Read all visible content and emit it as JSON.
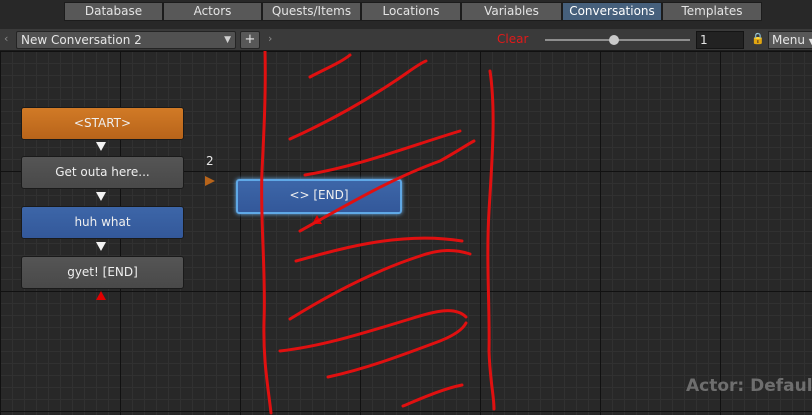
{
  "tabs": [
    {
      "label": "Database",
      "active": false
    },
    {
      "label": "Actors",
      "active": false
    },
    {
      "label": "Quests/Items",
      "active": false
    },
    {
      "label": "Locations",
      "active": false
    },
    {
      "label": "Variables",
      "active": false
    },
    {
      "label": "Conversations",
      "active": true
    },
    {
      "label": "Templates",
      "active": false
    }
  ],
  "toolbar": {
    "conversation": "New Conversation 2",
    "add_label": "+",
    "clear_label": "Clear",
    "zoom_value": "1",
    "menu_label": "Menu"
  },
  "nodes": {
    "start": "<START>",
    "n1": "Get outa here...",
    "n2": "huh what",
    "n3": "gyet! [END]",
    "selected": "<> [END]"
  },
  "link_count": "2",
  "actor_label": "Actor: Default",
  "colors": {
    "start_node": "#c86f20",
    "npc_node": "#515151",
    "pc_node": "#3a62a3",
    "selection_glow": "#5fa8e6",
    "annotation": "#e01010"
  }
}
